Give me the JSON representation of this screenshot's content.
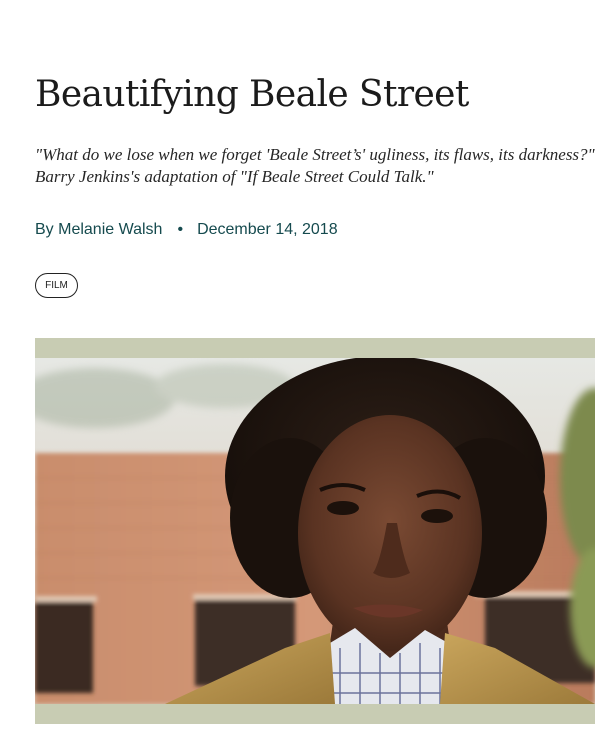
{
  "article": {
    "title": "Beautifying Beale Street",
    "dek": "\"What do we lose when we forget 'Beale Street’s' ugliness, its flaws, its darkness?\" On Barry Jenkins's adaptation of \"If Beale Street Could Talk.\"",
    "byline": {
      "author": "By Melanie Walsh",
      "separator": "•",
      "date": "December 14, 2018"
    },
    "tag": "FILM"
  },
  "colors": {
    "title": "#1b1b1b",
    "byline": "#154a4e",
    "image_frame": "#c8ccb3"
  },
  "hero_image": {
    "icon": "portrait-photo"
  }
}
